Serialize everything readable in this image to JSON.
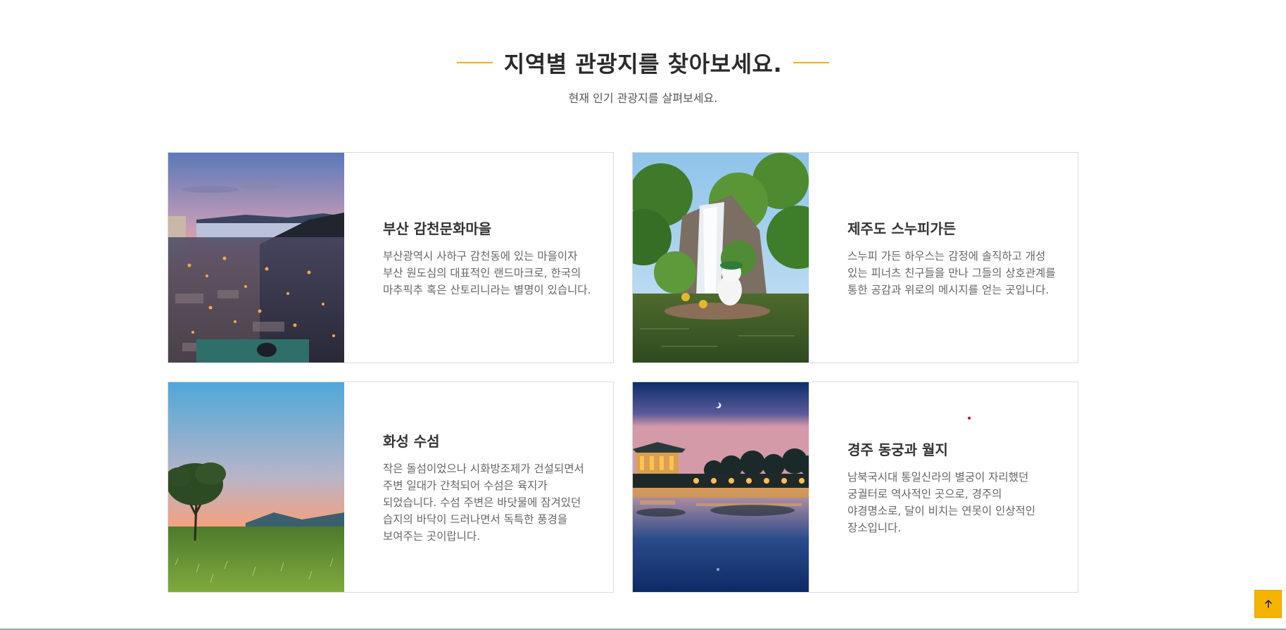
{
  "section": {
    "title": "지역별 관광지를 찾아보세요.",
    "subtitle": "현재 인기 관광지를 살펴보세요."
  },
  "cards": [
    {
      "name": "부산 감천문화마을",
      "description": "부산광역시 사하구 감천동에 있는 마을이자 부산 원도심의 대표적인 랜드마크로, 한국의 마추픽추 혹은 산토리니라는 별명이 있습니다.",
      "photo": "busan-gamcheon-village-photo"
    },
    {
      "name": "제주도 스누피가든",
      "description": "스누피 가든 하우스는 감정에 솔직하고 개성 있는 피너츠 친구들을 만나 그들의 상호관계를 통한 공감과 위로의 메시지를 얻는 곳입니다.",
      "photo": "jeju-snoopy-garden-photo"
    },
    {
      "name": "화성 수섬",
      "description": "작은 돌섬이었으나 시화방조제가 건설되면서 주변 일대가 간척되어 수섬은 육지가 되었습니다. 수섬 주변은 바닷물에 잠겨있던 습지의 바닥이 드러나면서 독특한 풍경을 보여주는 곳이랍니다.",
      "photo": "hwaseong-suseom-photo"
    },
    {
      "name": "경주 동궁과 월지",
      "description": "남북국시대 통일신라의 별궁이 자리했던 궁궐터로 역사적인 곳으로, 경주의 야경명소로, 달이 비치는 연못이 인상적인 장소입니다.",
      "photo": "gyeongju-donggung-wolji-photo"
    }
  ],
  "scroll_top": {
    "icon": "arrow-up-icon"
  },
  "colors": {
    "accent": "#f5b400",
    "text": "#333333",
    "muted": "#666666",
    "border": "#dcdcdc"
  }
}
